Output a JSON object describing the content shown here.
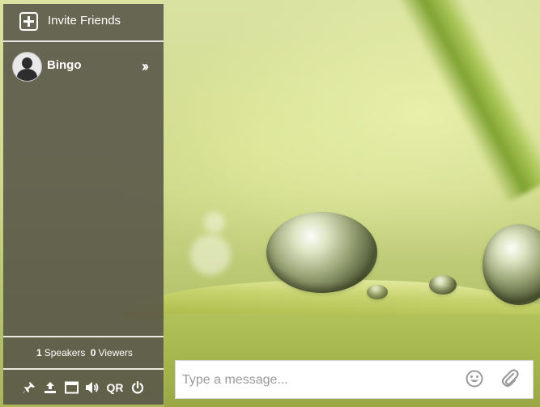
{
  "sidebar": {
    "invite_label": "Invite Friends",
    "invite_icon": "plus-square-icon",
    "users": [
      {
        "name": "Bingo",
        "avatar_icon": "user-avatar-icon",
        "expand_icon": "double-chevron-right-icon"
      }
    ],
    "counts": {
      "speakers_value": "1",
      "speakers_label": "Speakers",
      "viewers_value": "0",
      "viewers_label": "Viewers"
    },
    "toolbar": {
      "qr_label": "QR",
      "icons": [
        "pin-icon",
        "upload-icon",
        "window-icon",
        "volume-icon",
        "qr-icon",
        "power-icon"
      ]
    }
  },
  "message_bar": {
    "placeholder": "Type a message...",
    "value": "",
    "emoji_icon": "emoji-icon",
    "attach_icon": "paperclip-icon"
  },
  "colors": {
    "sidebar_bg": "#56544880",
    "divider": "#e8e8e2",
    "text": "#ffffff"
  }
}
